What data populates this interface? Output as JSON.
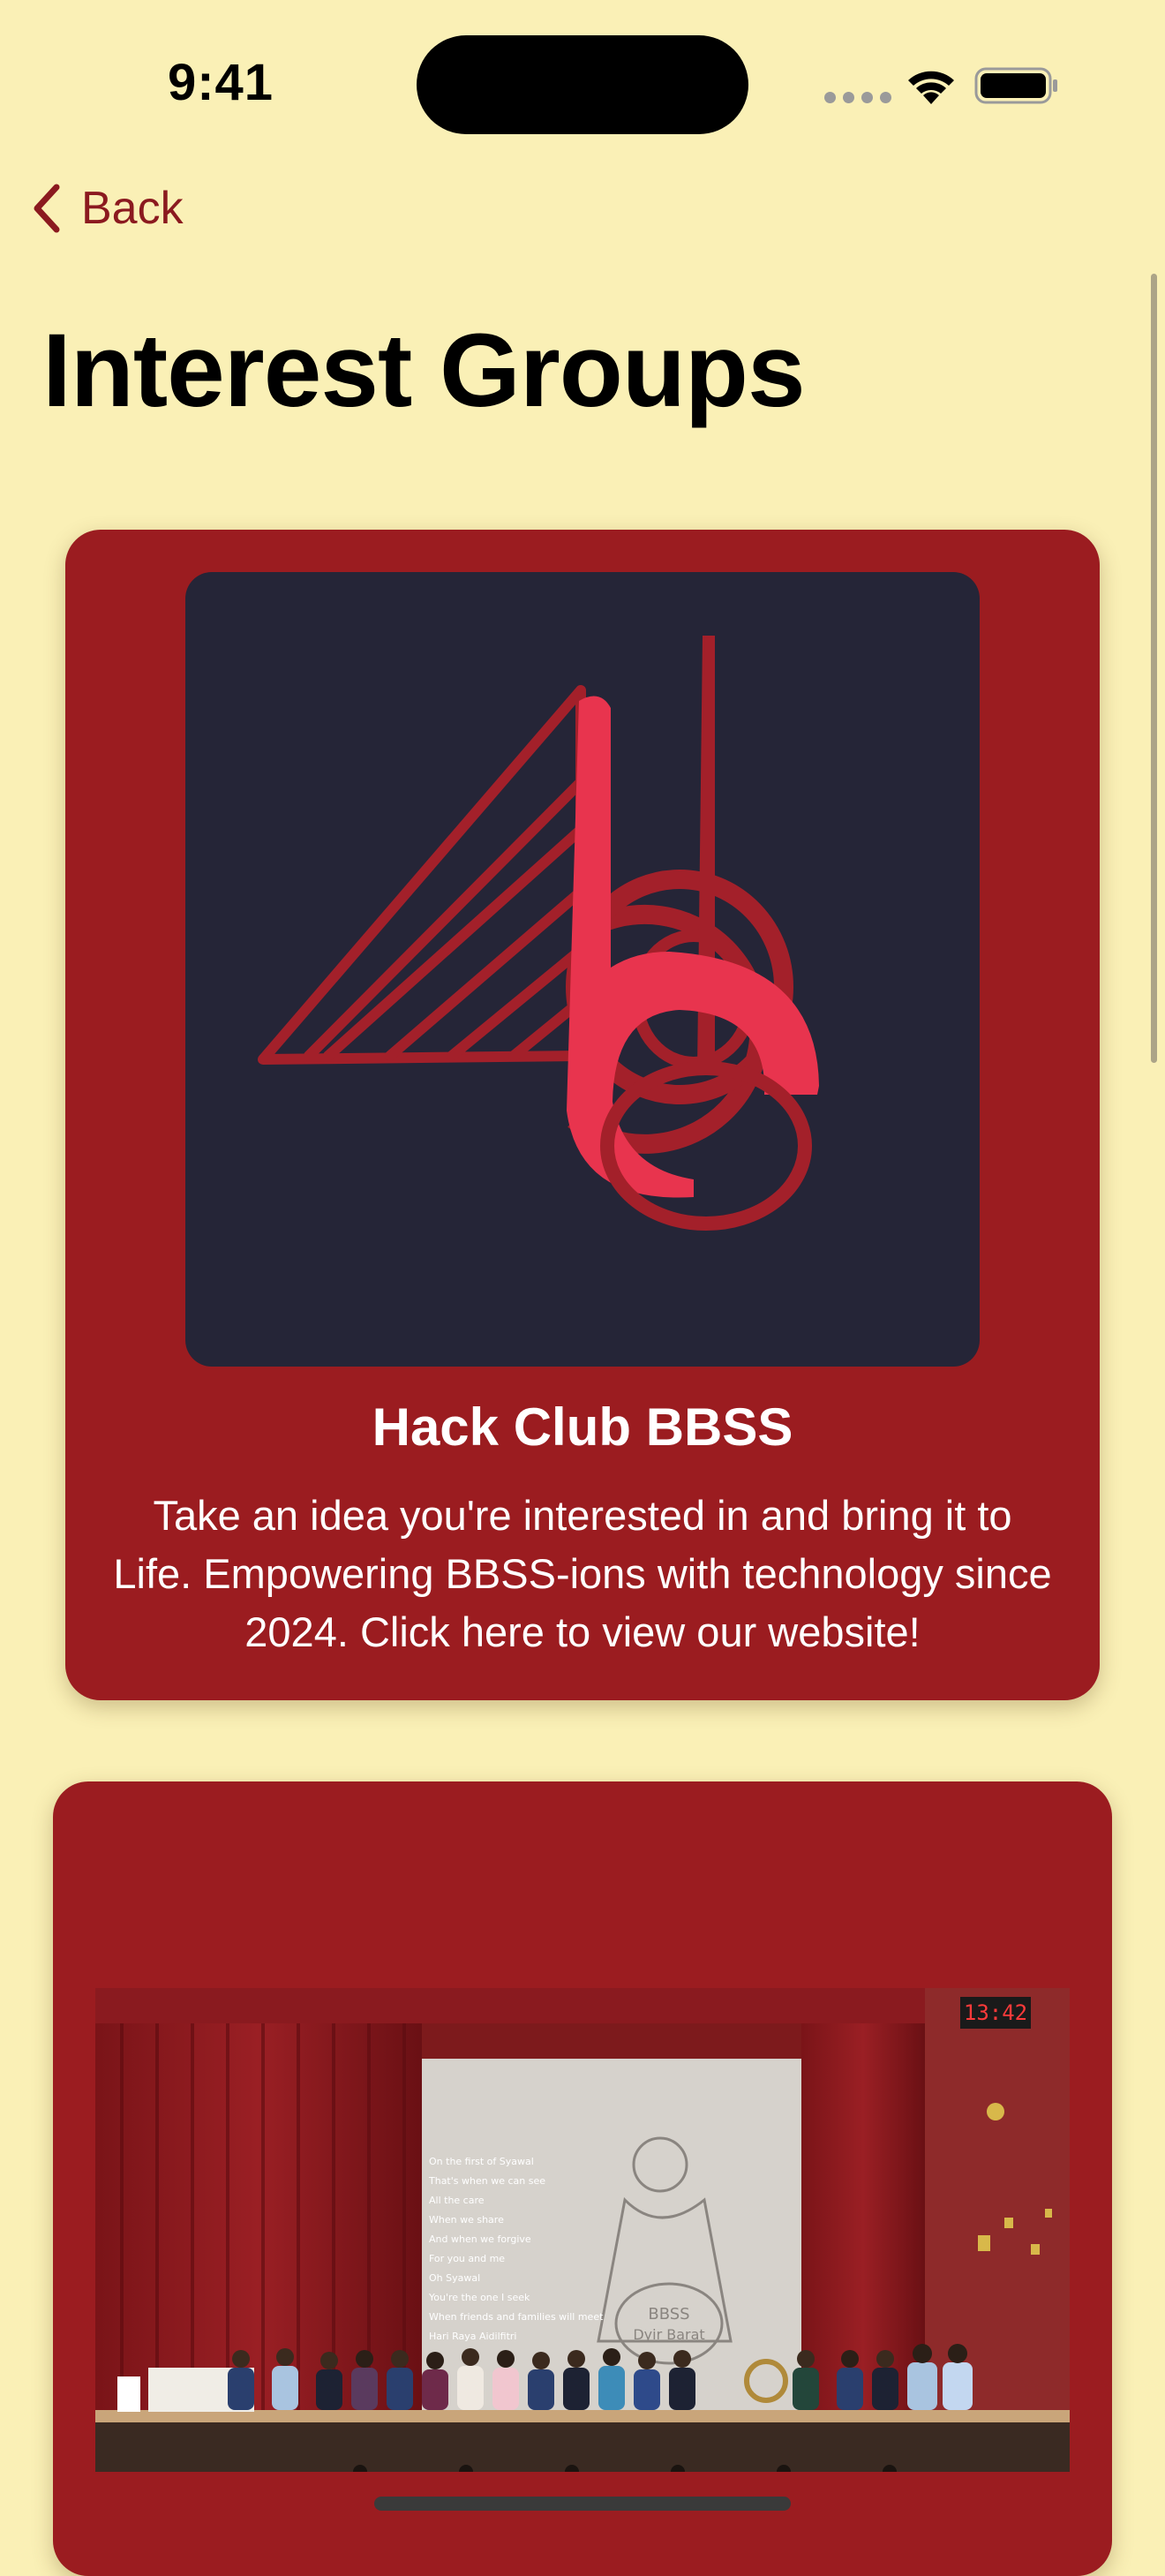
{
  "status_bar": {
    "time": "9:41"
  },
  "nav": {
    "back_label": "Back",
    "title": "Interest Groups"
  },
  "icons": {
    "back": "chevron-left-icon",
    "wifi": "wifi-icon",
    "battery": "battery-icon",
    "signal": "signal-dots-icon"
  },
  "cards": [
    {
      "title": "Hack Club BBSS",
      "description": "Take an idea you're interested in and bring it to Life. Empowering BBSS-ions with technology since 2024. Click here to view our website!",
      "image": "hack-club-bbss-logo"
    },
    {
      "image": "school-hall-stage-performance-photo",
      "photo_text": {
        "clock": "13:42",
        "screen_logo_line1": "BBSS",
        "screen_logo_line2": "Dyir Barat",
        "lyrics": [
          "On the first of Syawal",
          "That's when we can see",
          "All the care",
          "When we share",
          "And when we forgive",
          "For you and me",
          "Oh Syawal",
          "You're the one I seek",
          "When friends and families will meet",
          "Hari Raya Aidilfitri"
        ]
      }
    }
  ],
  "colors": {
    "background": "#FAF0B6",
    "card": "#9B1C20",
    "accent": "#8B1A1F",
    "logo_background": "#252537",
    "logo_pink": "#E8344E"
  }
}
